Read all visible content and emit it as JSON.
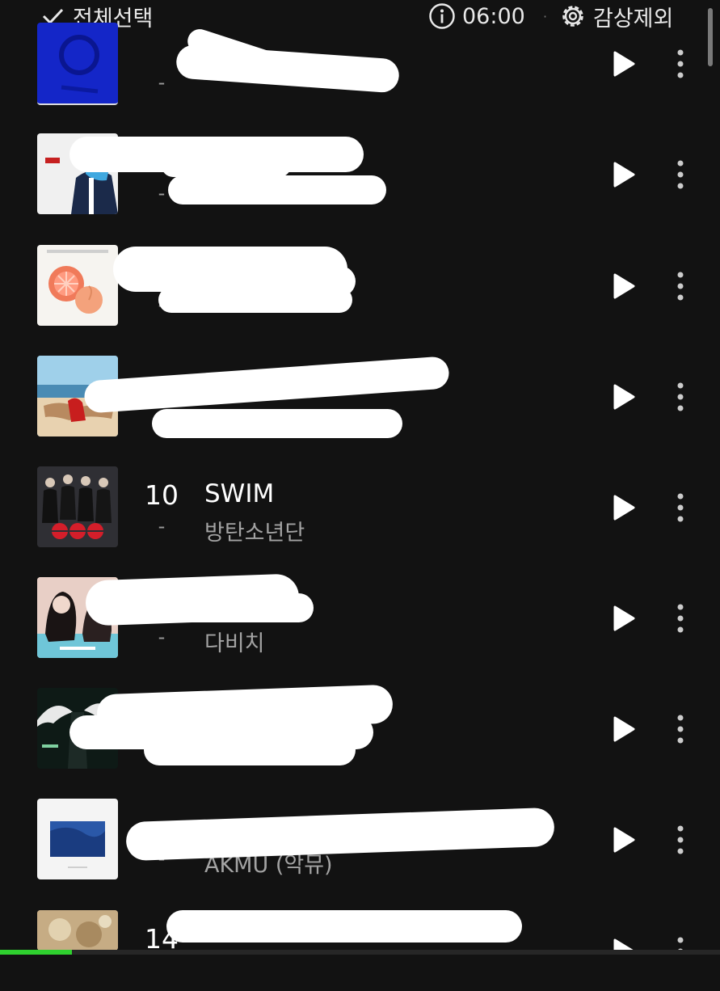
{
  "header": {
    "select_all": "전체선택",
    "time": "06:00",
    "separator": "·",
    "exclude": "감상제외"
  },
  "colors": {
    "accent": "#2fd02f",
    "background": "#121212"
  },
  "rows": [
    {
      "rank": "",
      "title": "",
      "artist": "",
      "dash": "-"
    },
    {
      "rank": "",
      "title": "",
      "artist": "",
      "dash": "-"
    },
    {
      "rank": "",
      "title": "",
      "artist": "",
      "dash": "-"
    },
    {
      "rank": "",
      "title": "",
      "artist": "",
      "dash": "-"
    },
    {
      "rank": "10",
      "title": "SWIM",
      "artist": "방탄소년단",
      "dash": "-"
    },
    {
      "rank": "",
      "title": "",
      "artist": "다비치",
      "dash": "-"
    },
    {
      "rank": "",
      "title": "",
      "artist": "",
      "dash": "-"
    },
    {
      "rank": "",
      "title": "",
      "artist": "AKMU (악뮤)",
      "dash": "-"
    },
    {
      "rank": "14",
      "title": "",
      "artist": "",
      "dash": ""
    }
  ],
  "icons": {
    "check": "check-icon",
    "info": "info-icon",
    "settings": "gear-icon",
    "play": "play-icon",
    "more": "more-vertical-icon"
  },
  "playback_progress": 0.1
}
